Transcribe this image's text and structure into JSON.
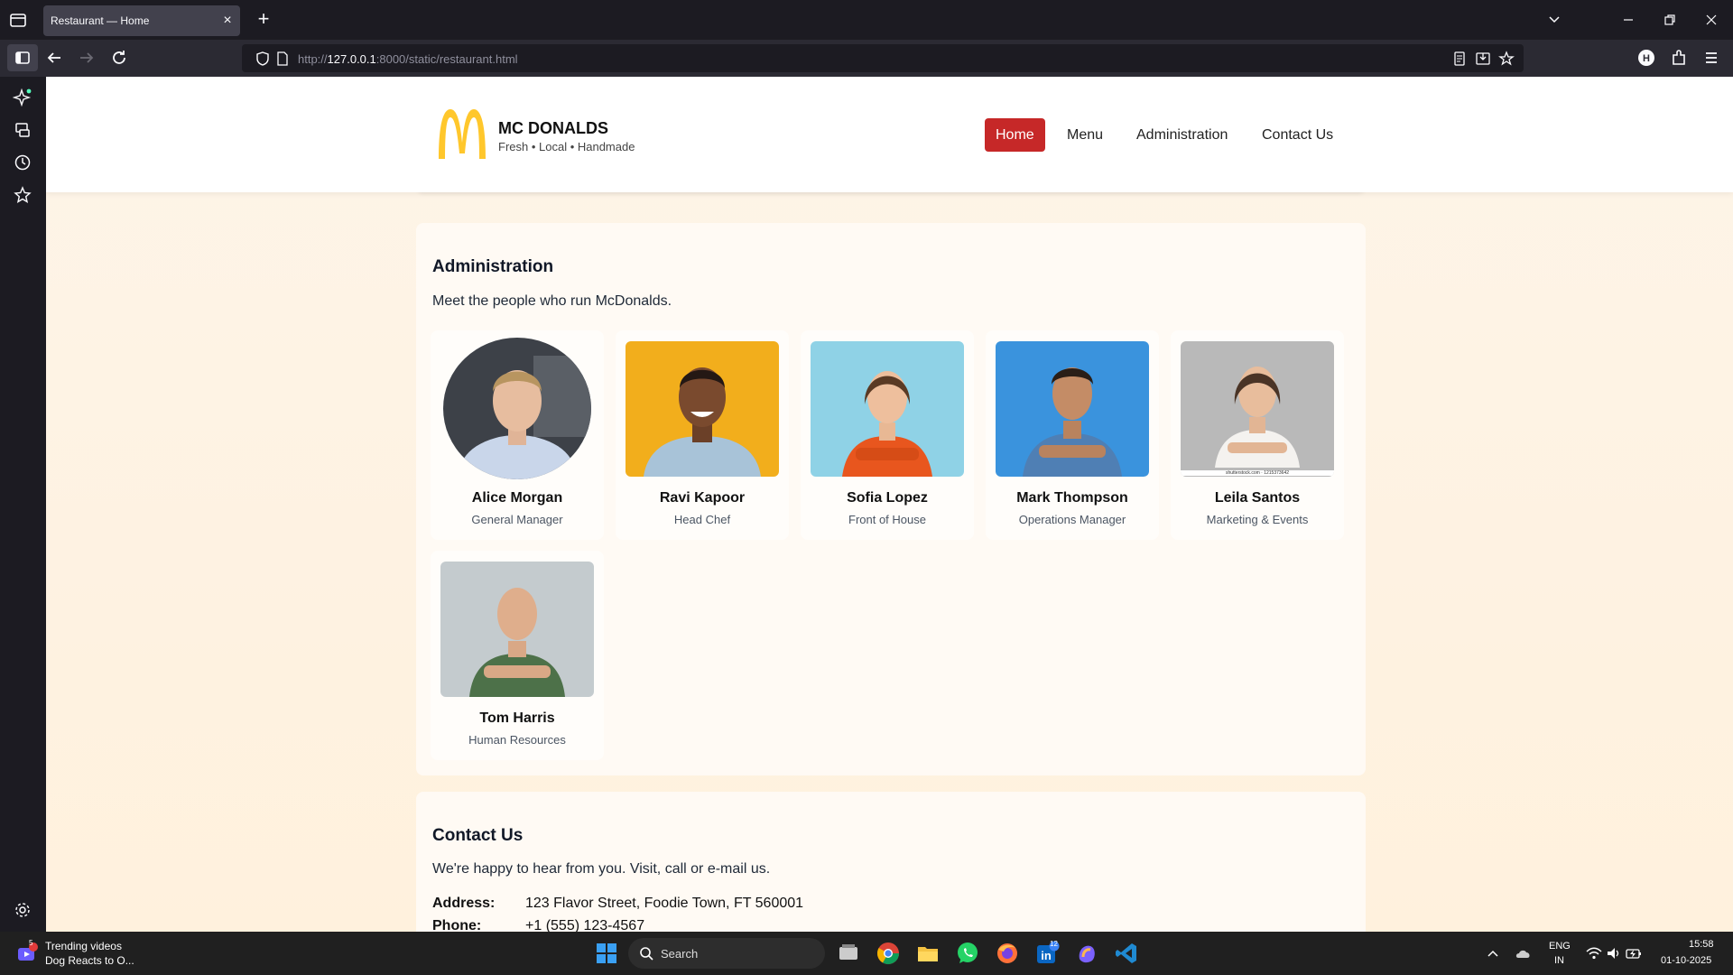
{
  "browser": {
    "tab_title": "Restaurant — Home",
    "url_prefix": "http://",
    "url_host": "127.0.0.1",
    "url_rest": ":8000/static/restaurant.html"
  },
  "header": {
    "brand": "MC DONALDS",
    "tagline": "Fresh • Local • Handmade",
    "nav": [
      "Home",
      "Menu",
      "Administration",
      "Contact Us"
    ],
    "active_nav": "Home"
  },
  "administration": {
    "title": "Administration",
    "subtitle": "Meet the people who run McDonalds.",
    "people": [
      {
        "name": "Alice Morgan",
        "role": "General Manager"
      },
      {
        "name": "Ravi Kapoor",
        "role": "Head Chef"
      },
      {
        "name": "Sofia Lopez",
        "role": "Front of House"
      },
      {
        "name": "Mark Thompson",
        "role": "Operations Manager"
      },
      {
        "name": "Leila Santos",
        "role": "Marketing & Events"
      },
      {
        "name": "Tom Harris",
        "role": "Human Resources"
      }
    ],
    "watermark": "shutterstock.com · 1215373642"
  },
  "contact": {
    "title": "Contact Us",
    "subtitle": "We're happy to hear from you. Visit, call or e-mail us.",
    "address_label": "Address:",
    "address": "123 Flavor Street, Foodie Town, FT 560001",
    "phone_label": "Phone:",
    "phone": "+1 (555) 123-4567"
  },
  "taskbar": {
    "news_title": "Trending videos",
    "news_sub": "Dog Reacts to O...",
    "news_badge": "5",
    "search": "Search",
    "lang1": "ENG",
    "lang2": "IN",
    "time": "15:58",
    "date": "01-10-2025",
    "linkedin_badge": "12"
  },
  "colors": {
    "brand_red": "#c62828",
    "arches_yellow": "#ffc72c"
  }
}
